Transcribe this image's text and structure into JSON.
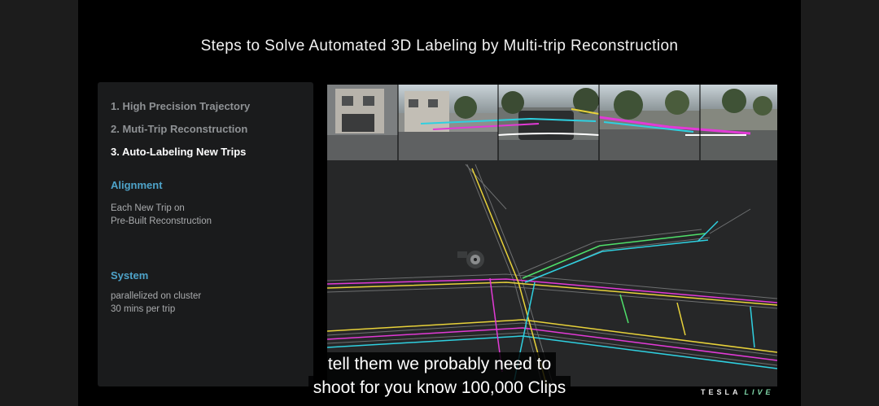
{
  "slide": {
    "title": "Steps to Solve Automated 3D Labeling by Multi-trip Reconstruction",
    "steps": [
      {
        "label": "1. High Precision Trajectory"
      },
      {
        "label": "2. Muti-Trip Reconstruction"
      },
      {
        "label": "3. Auto-Labeling New Trips"
      }
    ],
    "alignment": {
      "heading": "Alignment",
      "lines": [
        "Each New Trip on",
        "Pre-Built Reconstruction"
      ]
    },
    "system": {
      "heading": "System",
      "lines": [
        "parallelized on cluster",
        "30 mins per trip"
      ]
    }
  },
  "captions": [
    "tell them we probably need to",
    "shoot for you know 100,000 Clips"
  ],
  "brand": {
    "name": "TESLA",
    "suffix": "LIVE"
  },
  "colors": {
    "accent": "#4ea3c9",
    "brand_suffix": "#7fd6a8",
    "lane_magenta": "#e23ad6",
    "lane_cyan": "#2fd0e0",
    "lane_yellow": "#e8d23a",
    "lane_green": "#4fe06a"
  },
  "icons": {
    "ego_vehicle": "ego-vehicle-marker-icon"
  }
}
